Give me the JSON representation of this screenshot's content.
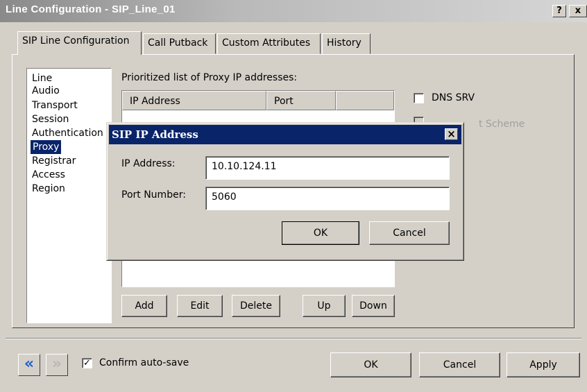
{
  "window": {
    "title": "Line Configuration - SIP_Line_01",
    "help_label": "?",
    "close_label": "x"
  },
  "tabs": [
    {
      "label": "SIP Line Configuration",
      "active": true
    },
    {
      "label": "Call Putback",
      "active": false
    },
    {
      "label": "Custom Attributes",
      "active": false
    },
    {
      "label": "History",
      "active": false
    }
  ],
  "nav": {
    "items": [
      "Line",
      "Audio",
      "Transport",
      "Session",
      "Authentication",
      "Proxy",
      "Registrar",
      "Access",
      "Region"
    ],
    "selected": "Proxy"
  },
  "proxy": {
    "list_label": "Prioritized list of Proxy IP addresses:",
    "columns": [
      "IP Address",
      "Port"
    ],
    "buttons": {
      "add": "Add",
      "edit": "Edit",
      "delete": "Delete",
      "up": "Up",
      "down": "Down"
    },
    "dns_srv_label": "DNS SRV",
    "dns_srv_checked": false,
    "hidden_option_partial": "t Scheme"
  },
  "dialog": {
    "title": "SIP IP Address",
    "close_label": "×",
    "ip_label": "IP Address:",
    "ip_value": "10.10.124.11",
    "port_label": "Port Number:",
    "port_value": "5060",
    "ok_label": "OK",
    "cancel_label": "Cancel"
  },
  "footer": {
    "prev_icon": "«",
    "next_icon": "»",
    "confirm_label": "Confirm auto-save",
    "confirm_checked": true,
    "ok_label": "OK",
    "cancel_label": "Cancel",
    "apply_label": "Apply"
  },
  "colors": {
    "dialog_title_bg": "#0a246a",
    "selection_bg": "#0a246a",
    "face": "#d4d0c8",
    "nav_arrow_active": "#1f5fc8"
  }
}
